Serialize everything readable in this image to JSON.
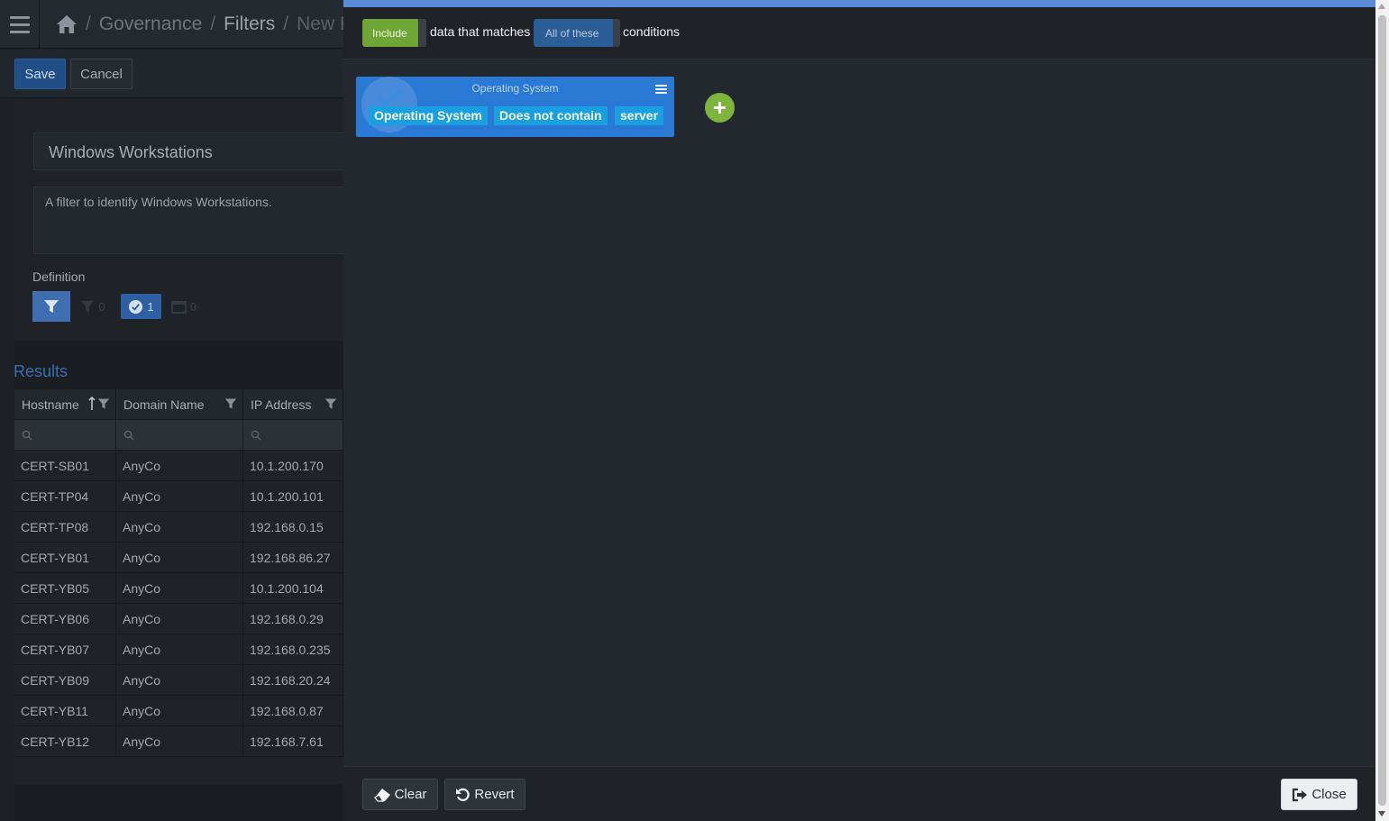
{
  "breadcrumb": {
    "items": [
      "Governance",
      "Filters",
      "New Fil"
    ],
    "separator": "/"
  },
  "toolbar": {
    "save_label": "Save",
    "cancel_label": "Cancel"
  },
  "form": {
    "name_value": "Windows Workstations",
    "description_value": "A filter to identify Windows Workstations.",
    "definition_label": "Definition",
    "tool_counts": {
      "filters": "0",
      "conditions": "1",
      "schedule": "0"
    }
  },
  "results": {
    "title": "Results",
    "columns": [
      "Hostname",
      "Domain Name",
      "IP Address"
    ],
    "rows": [
      [
        "CERT-SB01",
        "AnyCo",
        "10.1.200.170"
      ],
      [
        "CERT-TP04",
        "AnyCo",
        "10.1.200.101"
      ],
      [
        "CERT-TP08",
        "AnyCo",
        "192.168.0.15"
      ],
      [
        "CERT-YB01",
        "AnyCo",
        "192.168.86.27"
      ],
      [
        "CERT-YB05",
        "AnyCo",
        "10.1.200.104"
      ],
      [
        "CERT-YB06",
        "AnyCo",
        "192.168.0.29"
      ],
      [
        "CERT-YB07",
        "AnyCo",
        "192.168.0.235"
      ],
      [
        "CERT-YB09",
        "AnyCo",
        "192.168.20.24"
      ],
      [
        "CERT-YB11",
        "AnyCo",
        "192.168.0.87"
      ],
      [
        "CERT-YB12",
        "AnyCo",
        "192.168.7.61"
      ]
    ]
  },
  "modal": {
    "include_label": "Include",
    "matches_text": "data that matches",
    "match_mode_label": "All of these",
    "conditions_text": "conditions",
    "condition": {
      "title": "Operating System",
      "field": "Operating System",
      "operator": "Does not contain",
      "value": "server"
    },
    "footer": {
      "clear_label": "Clear",
      "revert_label": "Revert",
      "close_label": "Close"
    }
  },
  "colors": {
    "accent_blue": "#2a79d4",
    "include_green": "#6ea534",
    "add_green": "#7cb43c",
    "chip_blue": "#1a9fe0"
  },
  "icons": [
    "hamburger-icon",
    "home-icon",
    "filter-icon",
    "check-circle-icon",
    "calendar-icon",
    "sort-asc-icon",
    "search-icon",
    "plus-icon",
    "eraser-icon",
    "undo-icon",
    "sign-out-icon"
  ]
}
